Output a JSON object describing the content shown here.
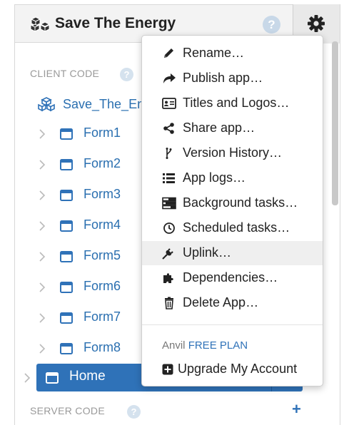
{
  "header": {
    "app_name": "Save The Energy",
    "help_glyph": "?"
  },
  "sidebar": {
    "client_code_label": "CLIENT CODE",
    "server_code_label": "SERVER CODE",
    "help_glyph": "?",
    "add_glyph": "+",
    "root_package": "Save_The_En",
    "forms": [
      "Form1",
      "Form2",
      "Form3",
      "Form4",
      "Form5",
      "Form6",
      "Form7",
      "Form8"
    ],
    "selected_form": "Home"
  },
  "menu": {
    "items": [
      {
        "label": "Rename…",
        "icon": "pencil-icon"
      },
      {
        "label": "Publish app…",
        "icon": "share-arrow-icon"
      },
      {
        "label": "Titles and Logos…",
        "icon": "id-card-icon"
      },
      {
        "label": "Share app…",
        "icon": "share-nodes-icon"
      },
      {
        "label": "Version History…",
        "icon": "branch-icon"
      },
      {
        "label": "App logs…",
        "icon": "list-icon"
      },
      {
        "label": "Background tasks…",
        "icon": "tasks-icon"
      },
      {
        "label": "Scheduled tasks…",
        "icon": "clock-icon"
      },
      {
        "label": "Uplink…",
        "icon": "plug-icon"
      },
      {
        "label": "Dependencies…",
        "icon": "puzzle-icon"
      },
      {
        "label": "Delete App…",
        "icon": "trash-icon"
      }
    ],
    "hovered_index": 8,
    "plan_prefix": "Anvil",
    "plan_name": "FREE PLAN",
    "upgrade_label": "Upgrade My Account"
  },
  "colors": {
    "accent": "#2f72b8",
    "header_bg": "#f3f3f3",
    "selected_row": "#2f72b8"
  }
}
